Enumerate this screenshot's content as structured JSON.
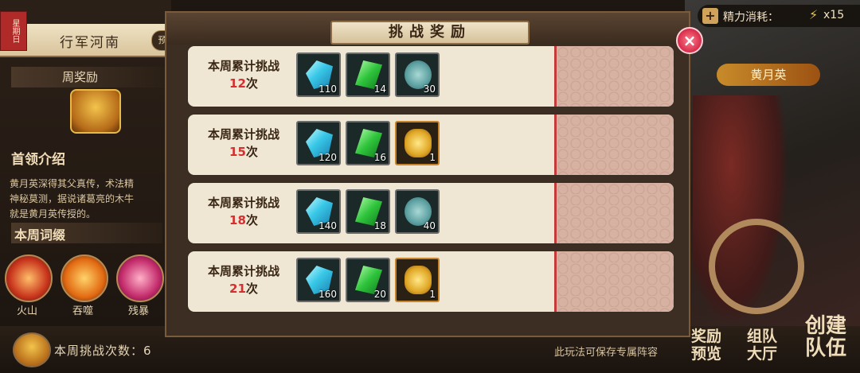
{
  "left_panel": {
    "week_flag": "星期日",
    "tab_title": "行军河南",
    "preview_button": "预",
    "weekly_reward_title": "周奖励",
    "boss_intro_title": "首领介绍",
    "boss_intro_text": "黄月英深得其父真传，术法精\n神秘莫测，据说诸葛亮的木牛\n就是黄月英传授的。",
    "weekly_affix_title": "本周词缀",
    "affixes": [
      {
        "label": "火山"
      },
      {
        "label": "吞噬"
      },
      {
        "label": "残暴"
      }
    ]
  },
  "bottom_bar": {
    "weekly_count_label": "本周挑战次数：6",
    "note": "此玩法可保存专属阵容"
  },
  "top_right": {
    "stamina_label": "精力消耗：",
    "stamina_value": "x15",
    "plus_label": "+",
    "bolt_icon": "⚡"
  },
  "boss_name": "黄月英",
  "right_buttons": {
    "reward_preview": "奖励\n预览",
    "team_hall": "组队\n大厅",
    "create_team": "创建\n队伍"
  },
  "modal": {
    "title": "挑战奖励",
    "close_label": "×",
    "rows": [
      {
        "prefix": "本周累计挑战",
        "count": "12",
        "suffix": "次",
        "items": [
          {
            "icon": "blue-gem-icon",
            "qty": "110"
          },
          {
            "icon": "green-gem-icon",
            "qty": "14"
          },
          {
            "icon": "jade-token-icon",
            "qty": "30"
          }
        ]
      },
      {
        "prefix": "本周累计挑战",
        "count": "15",
        "suffix": "次",
        "items": [
          {
            "icon": "blue-gem-icon",
            "qty": "120"
          },
          {
            "icon": "green-gem-icon",
            "qty": "16"
          },
          {
            "icon": "gold-seal-icon",
            "qty": "1"
          }
        ]
      },
      {
        "prefix": "本周累计挑战",
        "count": "18",
        "suffix": "次",
        "items": [
          {
            "icon": "blue-gem-icon",
            "qty": "140"
          },
          {
            "icon": "green-gem-icon",
            "qty": "18"
          },
          {
            "icon": "jade-token-icon",
            "qty": "40"
          }
        ]
      },
      {
        "prefix": "本周累计挑战",
        "count": "21",
        "suffix": "次",
        "items": [
          {
            "icon": "blue-gem-icon",
            "qty": "160"
          },
          {
            "icon": "green-gem-icon",
            "qty": "20"
          },
          {
            "icon": "gold-seal-icon",
            "qty": "1"
          }
        ]
      }
    ]
  },
  "colors": {
    "count_highlight": "#d43030",
    "row_background": "#efe7d3",
    "close_button": "#d62a48"
  }
}
